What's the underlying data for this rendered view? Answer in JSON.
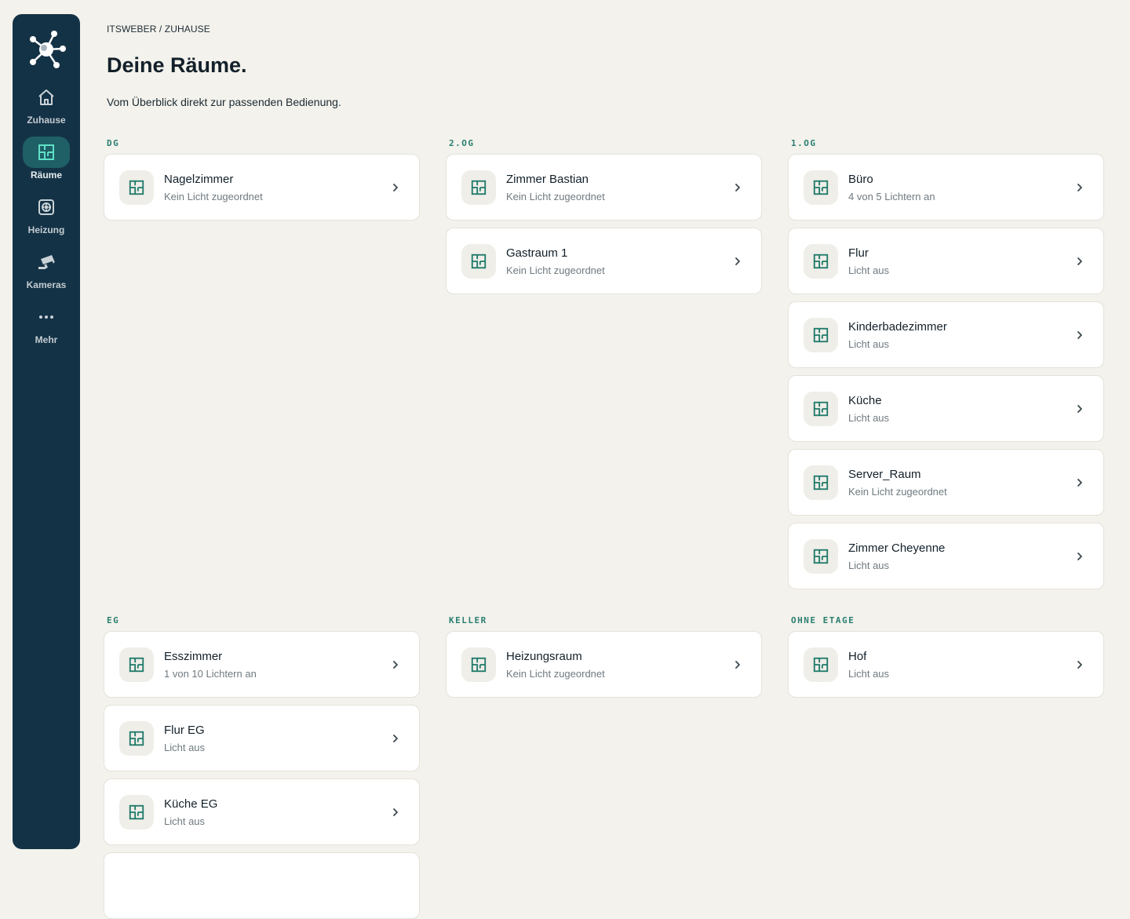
{
  "nav": {
    "items": [
      {
        "label": "Zuhause"
      },
      {
        "label": "Räume"
      },
      {
        "label": "Heizung"
      },
      {
        "label": "Kameras"
      },
      {
        "label": "Mehr"
      }
    ]
  },
  "header": {
    "breadcrumb": "ITSWEBER / ZUHAUSE",
    "title": "Deine Räume.",
    "subtitle": "Vom Überblick direkt zur passenden Bedienung."
  },
  "floors": [
    {
      "label": "DG",
      "rooms": [
        {
          "name": "Nagelzimmer",
          "status": "Kein Licht zugeordnet"
        }
      ]
    },
    {
      "label": "2.OG",
      "rooms": [
        {
          "name": "Zimmer Bastian",
          "status": "Kein Licht zugeordnet"
        },
        {
          "name": "Gastraum 1",
          "status": "Kein Licht zugeordnet"
        }
      ]
    },
    {
      "label": "1.OG",
      "rooms": [
        {
          "name": "Büro",
          "status": "4 von 5 Lichtern an"
        },
        {
          "name": "Flur",
          "status": "Licht aus"
        },
        {
          "name": "Kinderbadezimmer",
          "status": "Licht aus"
        },
        {
          "name": "Küche",
          "status": "Licht aus"
        },
        {
          "name": "Server_Raum",
          "status": "Kein Licht zugeordnet"
        },
        {
          "name": "Zimmer Cheyenne",
          "status": "Licht aus"
        }
      ]
    },
    {
      "label": "EG",
      "rooms": [
        {
          "name": "Esszimmer",
          "status": "1 von 10 Lichtern an"
        },
        {
          "name": "Flur EG",
          "status": "Licht aus"
        },
        {
          "name": "Küche EG",
          "status": "Licht aus"
        },
        {
          "name": "",
          "status": ""
        }
      ]
    },
    {
      "label": "KELLER",
      "rooms": [
        {
          "name": "Heizungsraum",
          "status": "Kein Licht zugeordnet"
        }
      ]
    },
    {
      "label": "OHNE ETAGE",
      "rooms": [
        {
          "name": "Hof",
          "status": "Licht aus"
        }
      ]
    }
  ],
  "colors": {
    "sidebar": "#143246",
    "accent": "#1f7a6a",
    "background": "#f3f2ec"
  }
}
